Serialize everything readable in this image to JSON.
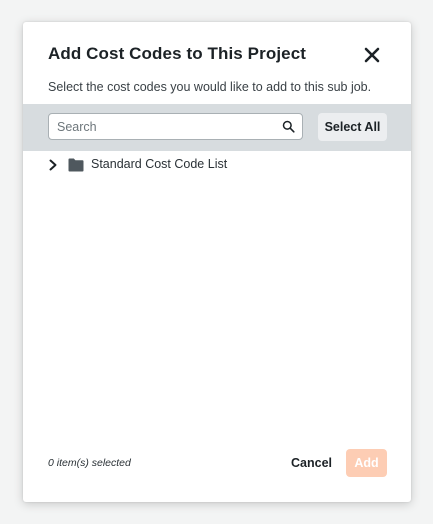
{
  "dialog": {
    "title": "Add Cost Codes to This Project",
    "subtitle": "Select the cost codes you would like to add to this sub job.",
    "close_icon": "close-icon"
  },
  "toolbar": {
    "search_placeholder": "Search",
    "search_value": "",
    "search_icon": "search-icon",
    "select_all_label": "Select All"
  },
  "tree": {
    "items": [
      {
        "label": "Standard Cost Code List",
        "expanded": false,
        "expand_icon": "chevron-right-icon",
        "item_icon": "folder-icon"
      }
    ]
  },
  "footer": {
    "selected_count": "0 item(s) selected",
    "cancel_label": "Cancel",
    "add_label": "Add",
    "add_disabled": true
  },
  "colors": {
    "toolbar_bg": "#d7dcdf",
    "add_disabled_bg": "#fdcdb4",
    "text_primary": "#1c2226"
  }
}
